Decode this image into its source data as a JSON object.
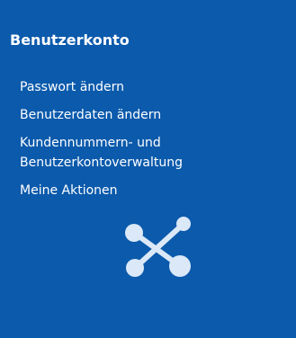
{
  "panel": {
    "title": "Benutzerkonto",
    "background_color": "#0b5aac",
    "text_color": "#ffffff",
    "menu": [
      {
        "lines": [
          "Passwort ändern"
        ]
      },
      {
        "lines": [
          "Benutzerdaten ändern"
        ]
      },
      {
        "lines": [
          "Kundennummern- und",
          "Benutzerkontoverwaltung"
        ]
      },
      {
        "lines": [
          "Meine Aktionen"
        ]
      }
    ],
    "illustration_icon": "network-connection-icon"
  }
}
